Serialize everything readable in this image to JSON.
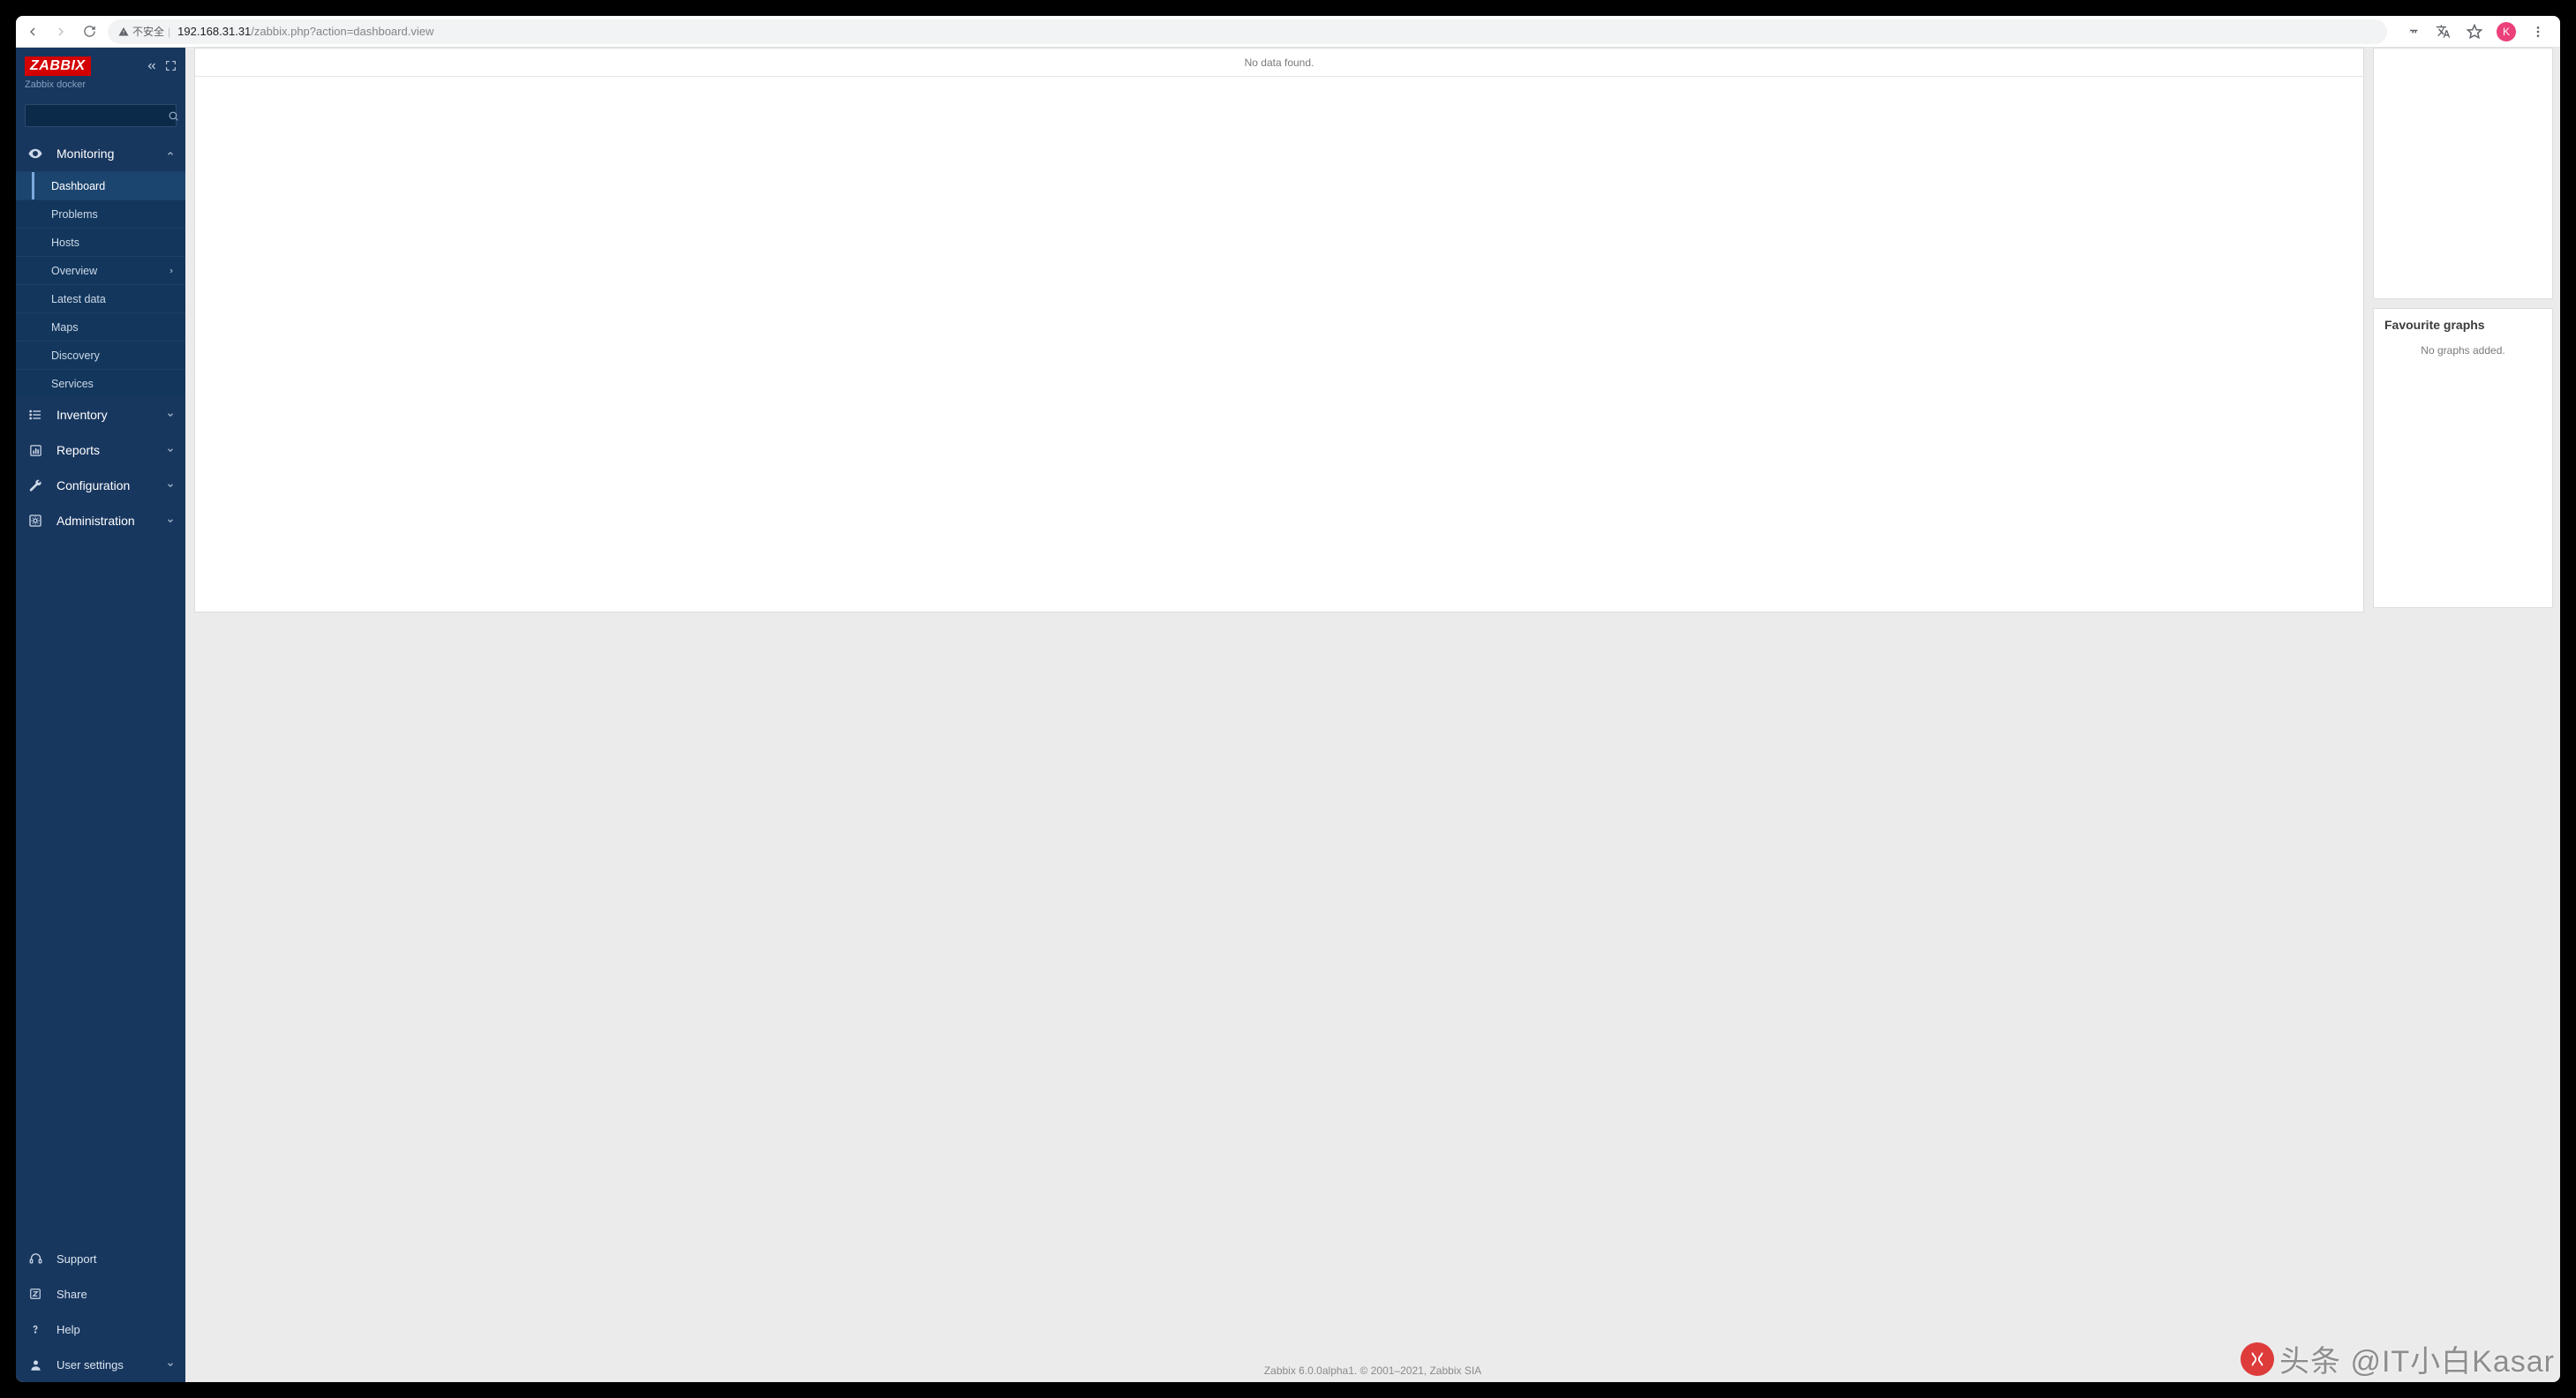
{
  "browser": {
    "security_label": "不安全",
    "url_host": "192.168.31.31",
    "url_path": "/zabbix.php?action=dashboard.view",
    "avatar_letter": "K"
  },
  "sidebar": {
    "logo_text": "ZABBIX",
    "subtitle": "Zabbix docker",
    "search_placeholder": "",
    "sections": {
      "monitoring": "Monitoring",
      "inventory": "Inventory",
      "reports": "Reports",
      "configuration": "Configuration",
      "administration": "Administration",
      "support": "Support",
      "share": "Share",
      "help": "Help",
      "user_settings": "User settings"
    },
    "monitoring_items": {
      "dashboard": "Dashboard",
      "problems": "Problems",
      "hosts": "Hosts",
      "overview": "Overview",
      "latest_data": "Latest data",
      "maps": "Maps",
      "discovery": "Discovery",
      "services": "Services"
    }
  },
  "main": {
    "no_data": "No data found.",
    "fav_graphs_title": "Favourite graphs",
    "fav_graphs_empty": "No graphs added.",
    "footer": "Zabbix 6.0.0alpha1. © 2001–2021, Zabbix SIA"
  },
  "watermark": {
    "text": "头条 @IT小白Kasar"
  }
}
